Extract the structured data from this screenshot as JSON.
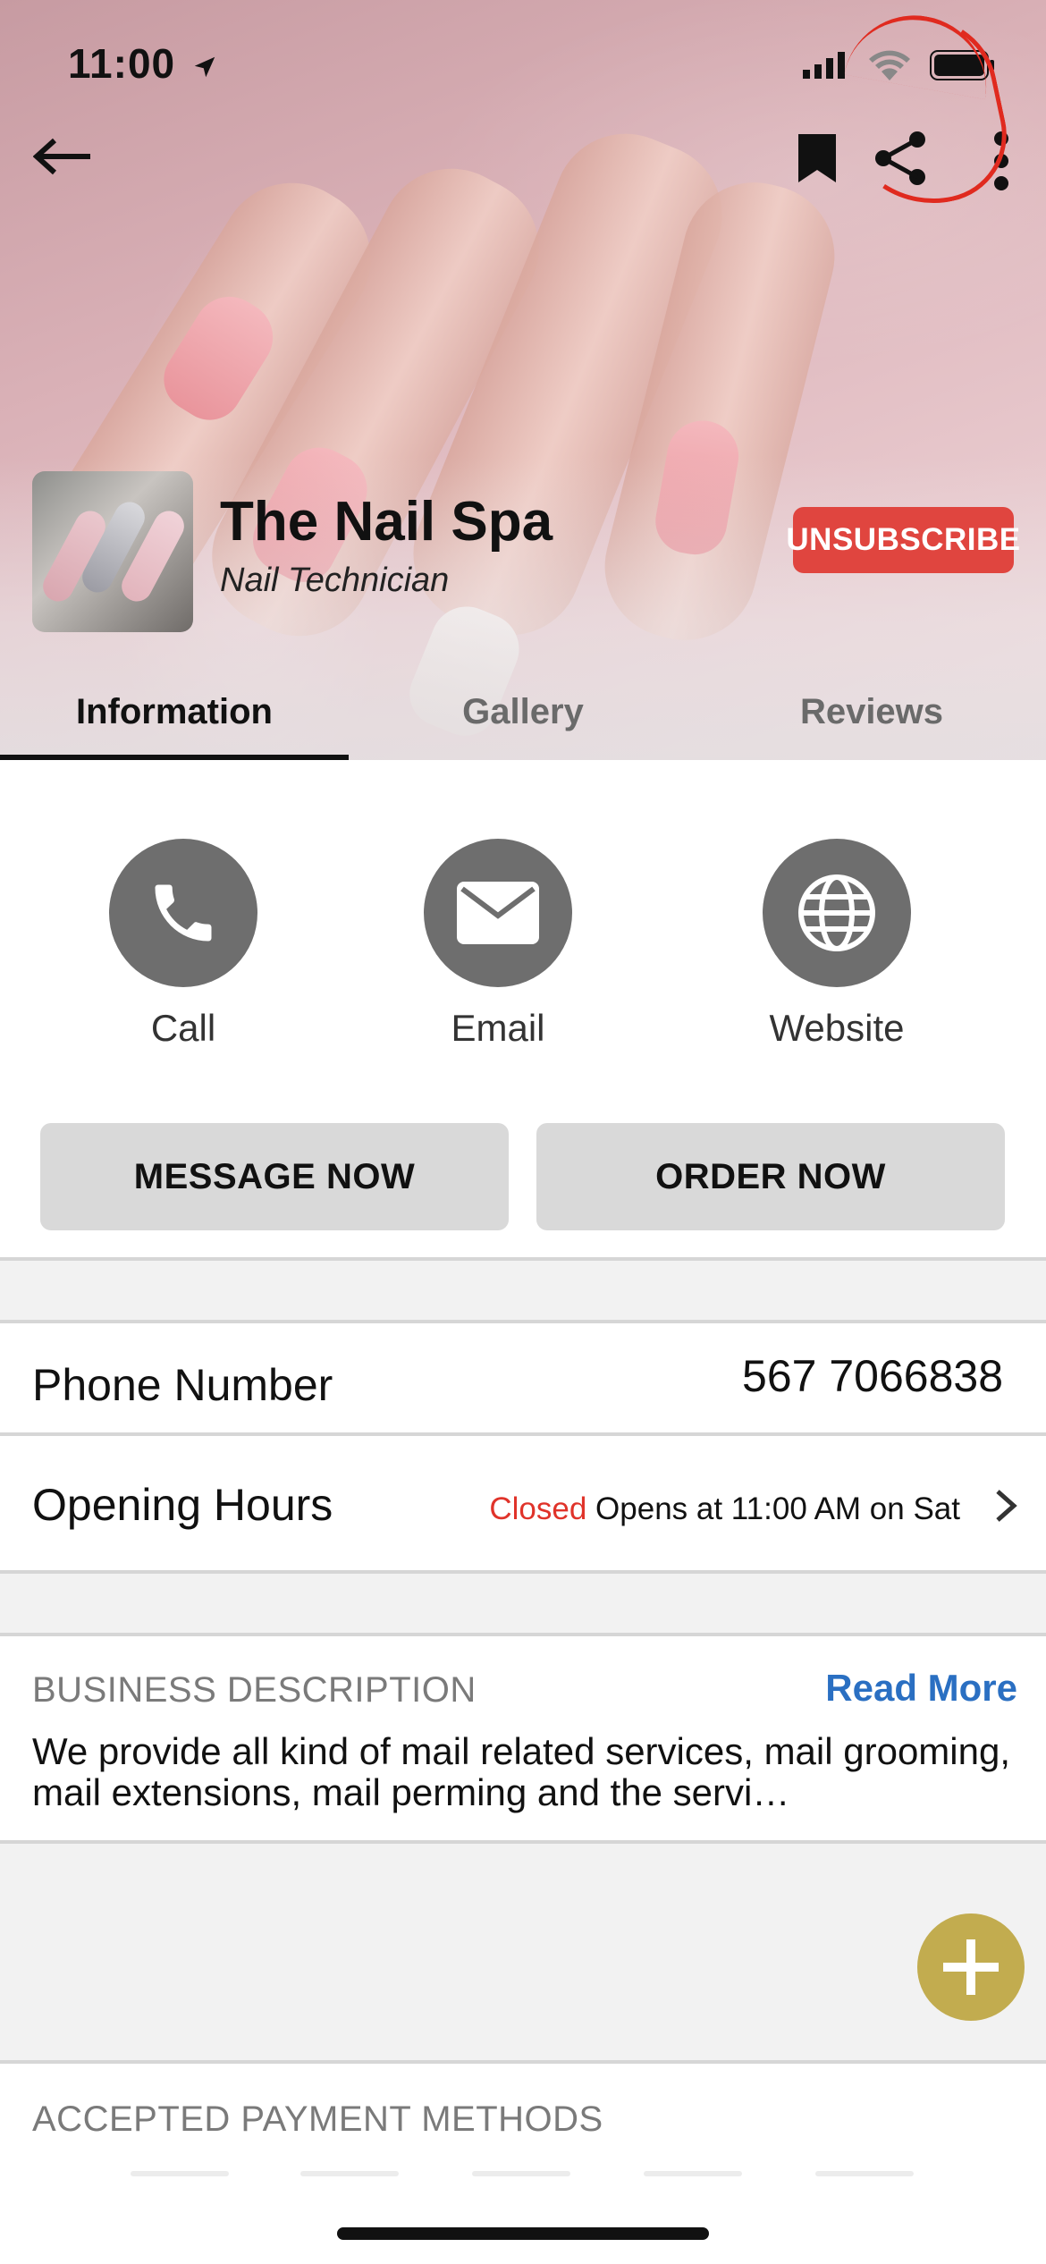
{
  "status_bar": {
    "time": "11:00"
  },
  "header": {
    "business_name": "The Nail Spa",
    "business_role": "Nail Technician",
    "unsubscribe_label": "UNSUBSCRIBE"
  },
  "tabs": [
    {
      "label": "Information",
      "active": true
    },
    {
      "label": "Gallery",
      "active": false
    },
    {
      "label": "Reviews",
      "active": false
    }
  ],
  "contact_actions": [
    {
      "label": "Call",
      "icon": "phone-icon"
    },
    {
      "label": "Email",
      "icon": "mail-icon"
    },
    {
      "label": "Website",
      "icon": "globe-icon"
    }
  ],
  "buttons": {
    "message_now": "MESSAGE NOW",
    "order_now": "ORDER NOW"
  },
  "phone": {
    "label": "Phone Number",
    "value": "567 7066838"
  },
  "hours": {
    "label": "Opening Hours",
    "status": "Closed",
    "detail": "Opens at 11:00 AM on Sat"
  },
  "description": {
    "heading": "BUSINESS DESCRIPTION",
    "read_more": "Read More",
    "text": "We provide all kind of mail related services, mail grooming, mail extensions, mail perming and the servi…"
  },
  "payment": {
    "heading": "ACCEPTED PAYMENT METHODS"
  },
  "colors": {
    "unsubscribe": "#e0453f",
    "closed": "#e0332a",
    "link": "#2a6fc2",
    "fab": "#c2ac4f",
    "annotation": "#e02a1f"
  }
}
